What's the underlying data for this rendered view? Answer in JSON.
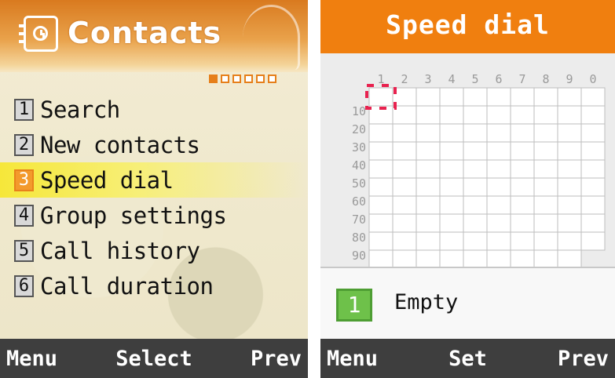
{
  "left_screen": {
    "title": "Contacts",
    "page_indicator": {
      "total": 6,
      "current": 1
    },
    "menu": [
      {
        "num": "1",
        "label": "Search",
        "selected": false
      },
      {
        "num": "2",
        "label": "New contacts",
        "selected": false
      },
      {
        "num": "3",
        "label": "Speed dial",
        "selected": true
      },
      {
        "num": "4",
        "label": "Group settings",
        "selected": false
      },
      {
        "num": "5",
        "label": "Call history",
        "selected": false
      },
      {
        "num": "6",
        "label": "Call duration",
        "selected": false
      }
    ],
    "softkeys": {
      "left": "Menu",
      "center": "Select",
      "right": "Prev"
    }
  },
  "right_screen": {
    "title": "Speed dial",
    "grid": {
      "column_labels": [
        "1",
        "2",
        "3",
        "4",
        "5",
        "6",
        "7",
        "8",
        "9",
        "0"
      ],
      "row_labels": [
        "10",
        "20",
        "30",
        "40",
        "50",
        "60",
        "70",
        "80",
        "90"
      ],
      "selected_slot": "1"
    },
    "selected_number": "1",
    "status": "Empty",
    "softkeys": {
      "left": "Menu",
      "center": "Set",
      "right": "Prev"
    }
  },
  "colors": {
    "accent": "#f07f0f",
    "selection": "#e8224f",
    "badge": "#6ec14a",
    "softbar": "#3e3e3e"
  }
}
